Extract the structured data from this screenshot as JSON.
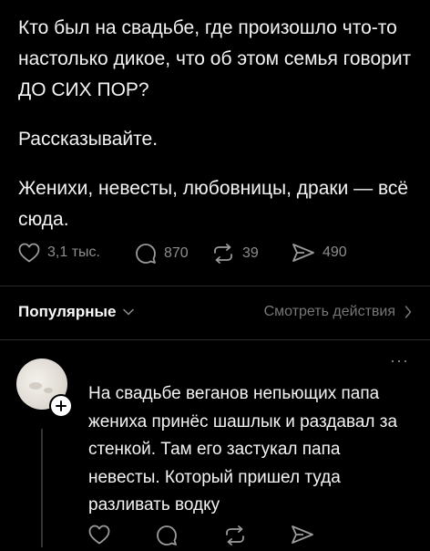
{
  "post": {
    "paragraphs": [
      "Кто был на свадьбе, где произошло что-то настолько дикое, что об этом семья говорит ДО СИХ ПОР?",
      "Рассказывайте.",
      "Женихи, невесты, любовницы, драки — всё сюда."
    ],
    "likes": "3,1 тыс.",
    "comments": "870",
    "reposts": "39",
    "shares": "490"
  },
  "sort": {
    "label": "Популярные",
    "view_activity": "Смотреть действия"
  },
  "reply": {
    "text": "На свадьбе веганов непьющих папа жениха принёс шашлык и раздавал за стенкой. Там его застукал папа невесты. Который пришел туда разливать водку",
    "more": "···"
  },
  "icons": {
    "like": "heart-icon",
    "comment": "comment-bubble-icon",
    "repost": "repost-icon",
    "share": "send-icon",
    "chevron_down": "chevron-down-icon",
    "chevron_right": "chevron-right-icon",
    "follow": "plus-icon"
  }
}
